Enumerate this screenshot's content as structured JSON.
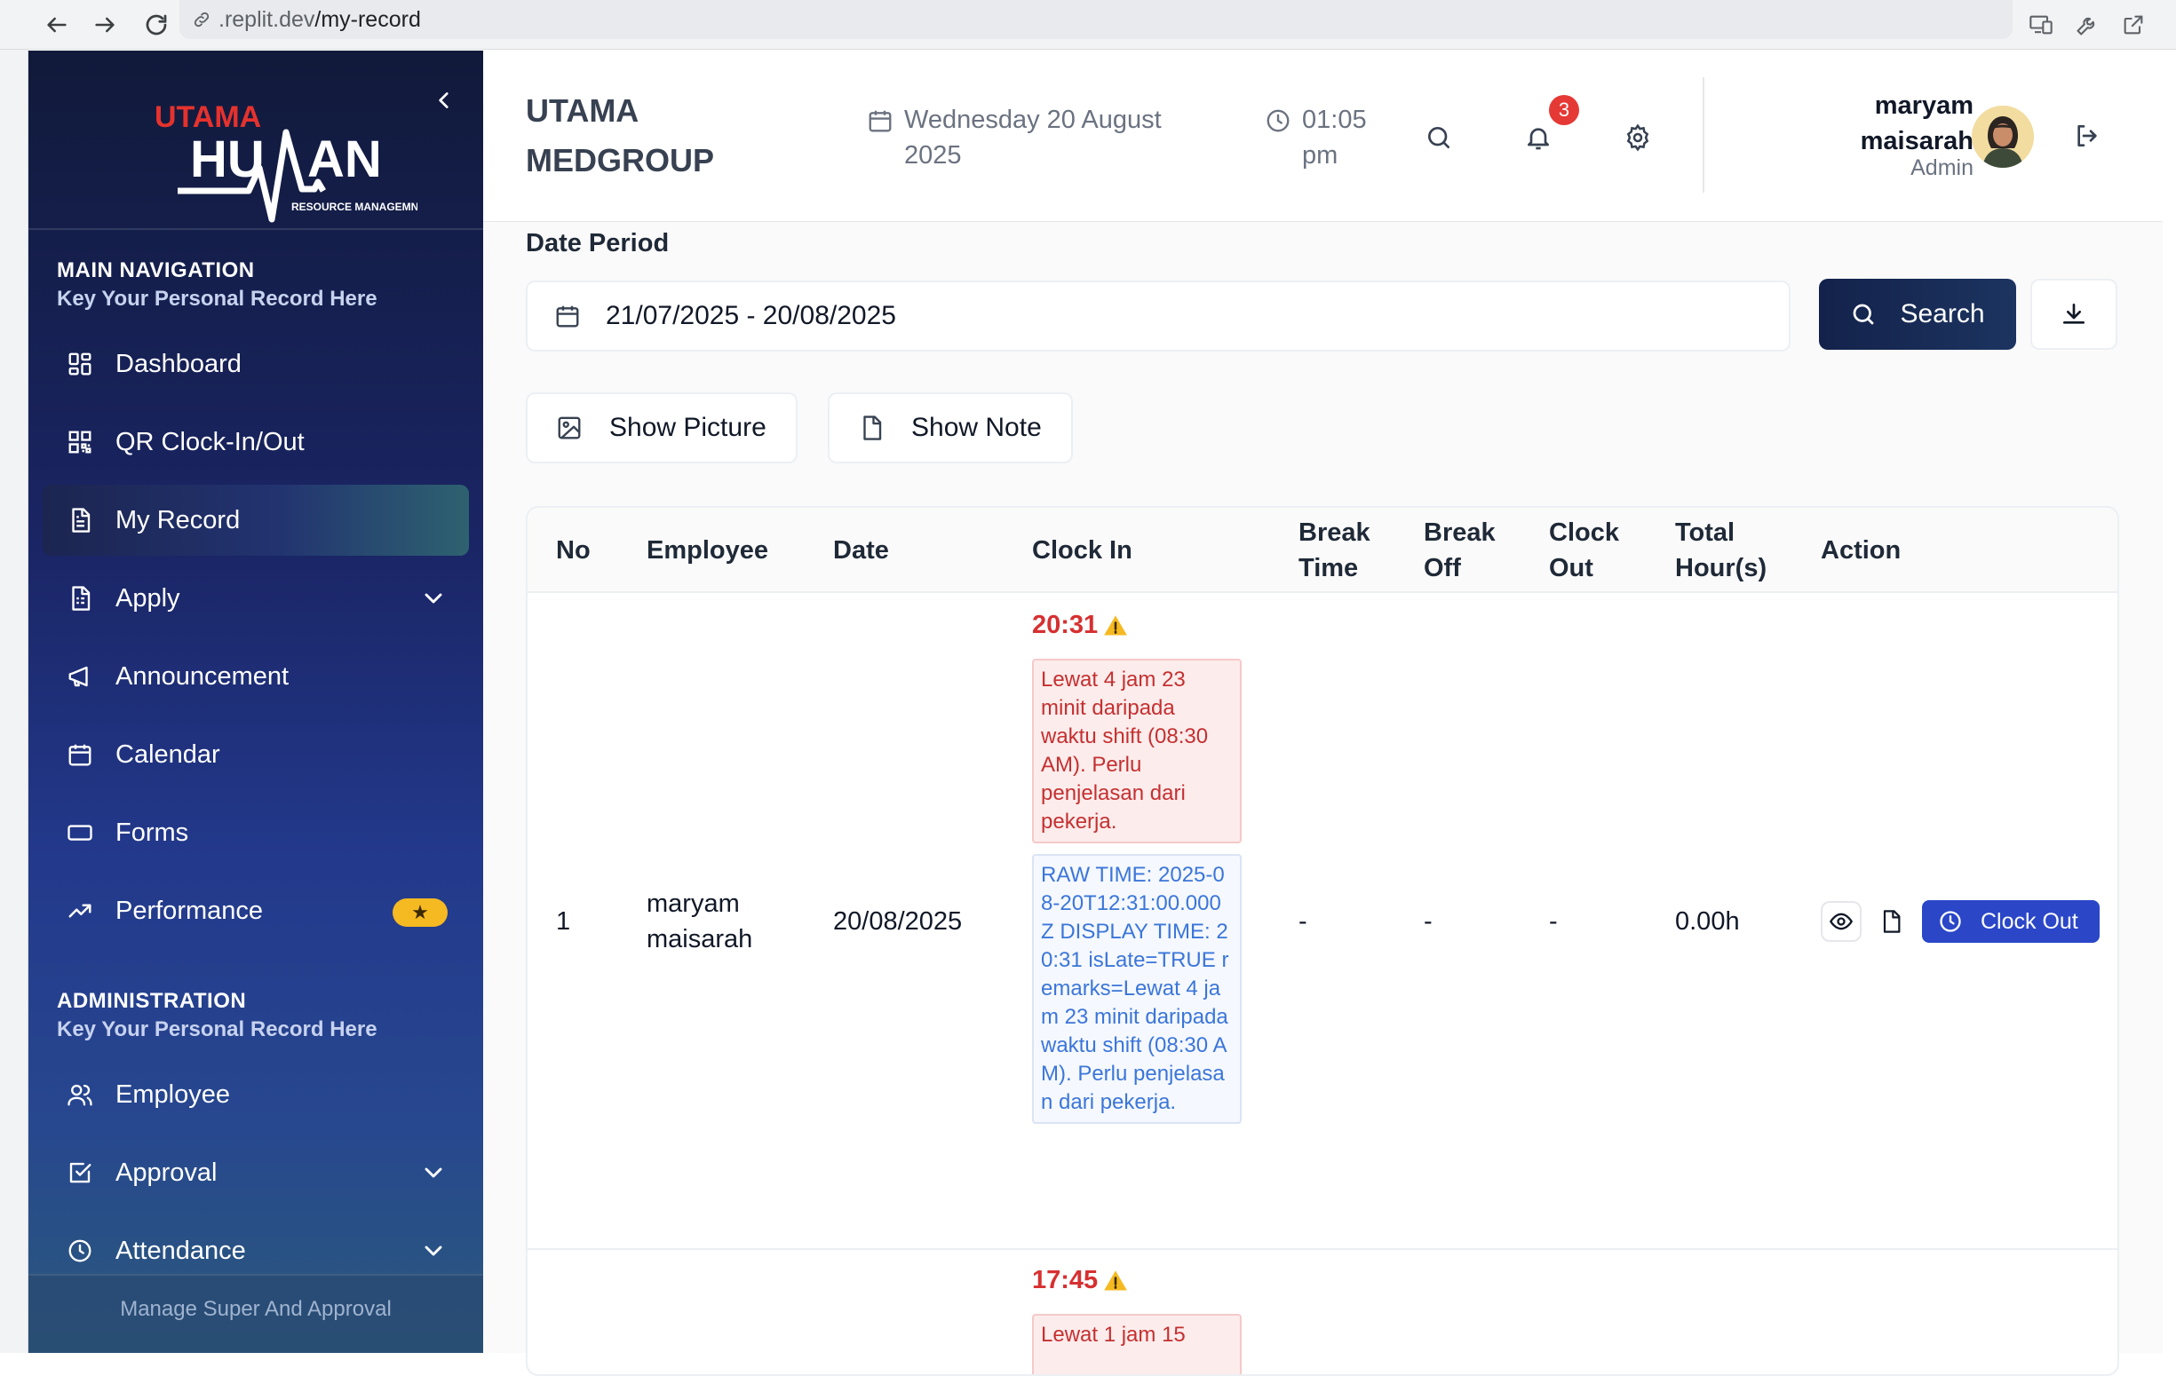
{
  "browser": {
    "url_host": ".replit.dev",
    "url_path": "/my-record"
  },
  "sidebar": {
    "logo_top": "UTAMA",
    "logo_main": "HUMAN",
    "logo_sub": "RESOURCE MANAGEMNET",
    "main_nav": {
      "title": "MAIN NAVIGATION",
      "subtitle": "Key Your Personal Record Here",
      "items": [
        {
          "label": "Dashboard",
          "icon": "dashboard-icon"
        },
        {
          "label": "QR Clock-In/Out",
          "icon": "qr-code-icon"
        },
        {
          "label": "My Record",
          "icon": "document-icon",
          "active": true
        },
        {
          "label": "Apply",
          "icon": "file-list-icon",
          "has_submenu": true
        },
        {
          "label": "Announcement",
          "icon": "megaphone-icon"
        },
        {
          "label": "Calendar",
          "icon": "calendar-icon"
        },
        {
          "label": "Forms",
          "icon": "form-icon"
        },
        {
          "label": "Performance",
          "icon": "trending-up-icon",
          "badge": "★"
        }
      ]
    },
    "admin_nav": {
      "title": "ADMINISTRATION",
      "subtitle": "Key Your Personal Record Here",
      "items": [
        {
          "label": "Employee",
          "icon": "users-icon"
        },
        {
          "label": "Approval",
          "icon": "checkbox-icon",
          "has_submenu": true
        },
        {
          "label": "Attendance",
          "icon": "clock-icon",
          "has_submenu": true
        }
      ]
    },
    "footer_text": "Manage Super And Approval"
  },
  "header": {
    "company_name": "UTAMA MEDGROUP",
    "date": "Wednesday 20 August 2025",
    "time": "01:05 pm",
    "notification_count": "3",
    "user_name": "maryam maisarah",
    "user_role": "Admin"
  },
  "filters": {
    "date_period_label": "Date Period",
    "date_range": "21/07/2025 - 20/08/2025",
    "search_label": "Search",
    "show_picture_label": "Show Picture",
    "show_note_label": "Show Note"
  },
  "table": {
    "columns": [
      "No",
      "Employee",
      "Date",
      "Clock In",
      "Break Time",
      "Break Off",
      "Clock Out",
      "Total Hour(s)",
      "Action"
    ],
    "rows": [
      {
        "no": "1",
        "employee": "maryam maisarah",
        "date": "20/08/2025",
        "clock_in": "20:31",
        "late_note": "Lewat 4 jam 23 minit daripada waktu shift (08:30 AM). Perlu penjelasan dari pekerja.",
        "raw_note": "RAW TIME: 2025-08-20T12:31:00.000Z DISPLAY TIME: 20:31 isLate=TRUE remarks=Lewat 4 jam 23 minit daripada waktu shift (08:30 AM). Perlu penjelasan dari pekerja.",
        "break_time": "-",
        "break_off": "-",
        "clock_out": "-",
        "total_hours": "0.00h",
        "action_label": "Clock Out"
      },
      {
        "clock_in": "17:45",
        "late_note": "Lewat 1 jam 15"
      }
    ]
  },
  "colors": {
    "accent": "#2b47c8",
    "late_red": "#d63031",
    "badge_gold": "#f5b921",
    "sidebar_dark": "#111a3a"
  }
}
